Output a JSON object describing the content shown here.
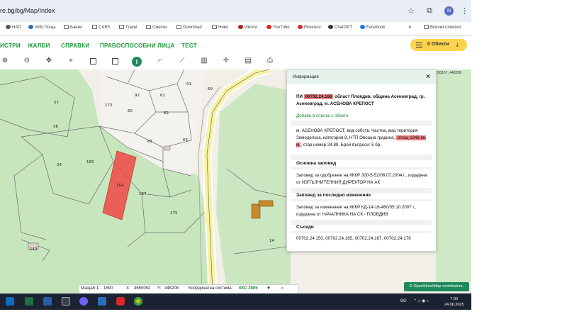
{
  "browser": {
    "address": "re.bg/bg/Map/Index",
    "profile_initial": "N",
    "bookmarks": [
      {
        "label": "НАП",
        "icon": "globe-icon"
      },
      {
        "label": "АББ Пощa",
        "icon": "mail-icon"
      },
      {
        "label": "Банки",
        "icon": "folder-icon"
      },
      {
        "label": "CARS",
        "icon": "folder-icon"
      },
      {
        "label": "Travel",
        "icon": "folder-icon"
      },
      {
        "label": "Сметки",
        "icon": "folder-icon"
      },
      {
        "label": "Download",
        "icon": "folder-icon"
      },
      {
        "label": "Ники",
        "icon": "folder-icon"
      },
      {
        "label": "Имоти",
        "icon": "record-icon"
      },
      {
        "label": "YouTube",
        "icon": "youtube-icon"
      },
      {
        "label": "Pinterest",
        "icon": "pinterest-icon"
      },
      {
        "label": "ChatGPT",
        "icon": "chatgpt-icon"
      },
      {
        "label": "Facebook",
        "icon": "facebook-icon"
      }
    ],
    "more_bookmarks": "»",
    "all_bookmarks": "Всички отметки"
  },
  "nav": {
    "items": [
      "ИСТРИ",
      "ЖАЛБИ",
      "СПРАВКИ",
      "ПРАВОСПОСОБНИ ЛИЦА",
      "ТЕСТ"
    ],
    "objects_button": "0 Обекти"
  },
  "map": {
    "corner_coordinates": "4650167, 448298",
    "parcel_labels": [
      "92",
      "61",
      "61",
      "69",
      "172",
      "60",
      "62",
      "57",
      "56",
      "63",
      "65",
      "24",
      "165",
      "164",
      "167",
      "175",
      "142",
      "14"
    ],
    "highlight_color": "#f04747"
  },
  "info_panel": {
    "title": "Информация",
    "close": "×",
    "parcel_prefix": "ПИ ",
    "parcel_id": "00702.24.166",
    "parcel_rest": " област Пловдив, община Асеновград, гр. Асеновград, м. АСЕНОВА КРЕПОСТ",
    "add_link": "Добави в списък с обекти",
    "details_before": "м. АСЕНОВА КРЕПОСТ, вид собств. Частна, вид територия Земеделска, категория 9, НТП Овощна градина, ",
    "details_area": "площ 1948 кв. м",
    "details_after": ", стар номер 24.89, Брой въпроси: 6 бр.",
    "main_order_heading": "Основна заповед",
    "main_order_text": "Заповед за одобрение на КККР 300-5-52/08.07.2004 г., издадена от ИЗПЪЛНИТЕЛНИЯ ДИРЕКТОР НА АК",
    "last_change_heading": "Заповед за последно изменение",
    "last_change_text": "Заповед за изменение на КККР КД-14-16-460/05.10.2007 г., издадена от НАЧАЛНИКА НА СК - ПЛОВДИВ",
    "neighbors_heading": "Съседи",
    "neighbors_text": "00702.24.150, 00702.24.165, 00702.24.167, 00702.24.176"
  },
  "status": {
    "scale_label": "Мащаб 1:",
    "scale_value": "1590",
    "x_label": "X:",
    "x_value": "4650092",
    "y_label": "Y:",
    "y_value": "448208",
    "crs_label": "Координатна система:",
    "crs_value": "ККС 2005"
  },
  "attribution": "© OpenStreetMap contributors.",
  "taskbar": {
    "lang": "BG",
    "time": "7:00",
    "date": "24.06.2025"
  }
}
